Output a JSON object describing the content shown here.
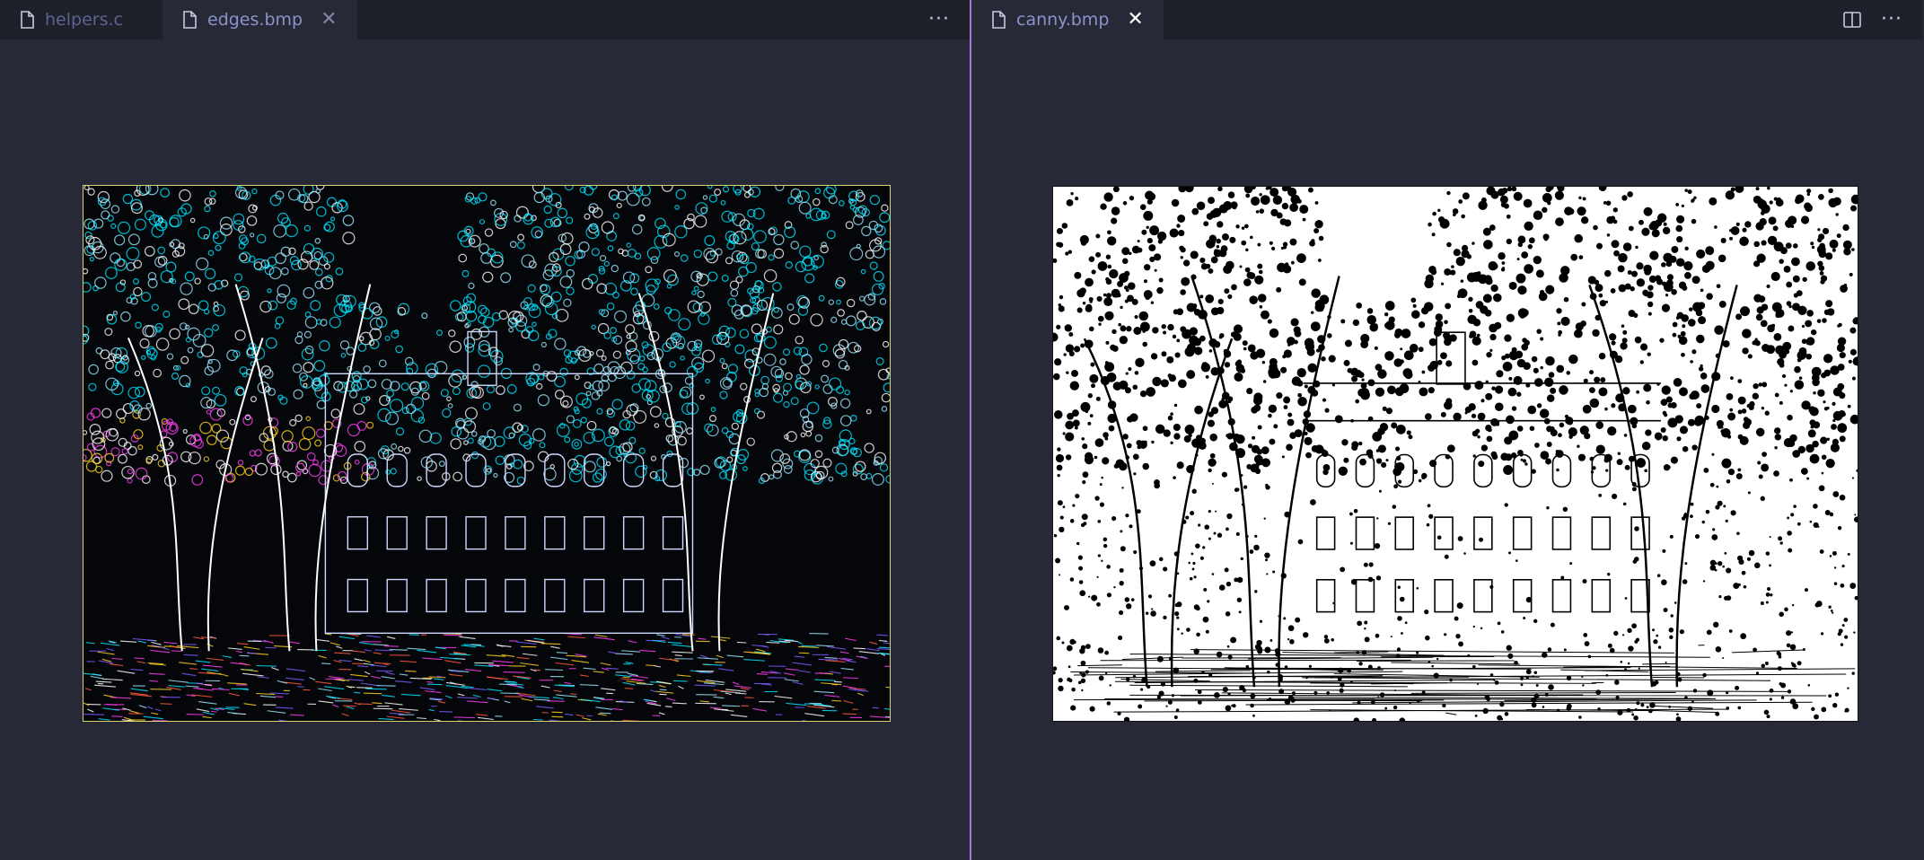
{
  "left_group": {
    "tabs": [
      {
        "label": "helpers.c",
        "icon": "file-icon",
        "active": false
      },
      {
        "label": "edges.bmp",
        "icon": "file-icon",
        "active": true
      }
    ],
    "more_label": "···",
    "image": {
      "file": "edges.bmp",
      "style": "edge-detected color",
      "accent_colors": [
        "#00e5ff",
        "#ff3df2",
        "#ffd21f",
        "#ffffff"
      ]
    }
  },
  "right_group": {
    "tabs": [
      {
        "label": "canny.bmp",
        "icon": "file-icon",
        "active": true
      }
    ],
    "more_label": "···",
    "image": {
      "file": "canny.bmp",
      "style": "black and white canny edges"
    }
  },
  "colors": {
    "background": "#272936",
    "tabbar": "#1e202a",
    "tab_text": "#8a93cc",
    "split_border": "#9f7fd6"
  }
}
